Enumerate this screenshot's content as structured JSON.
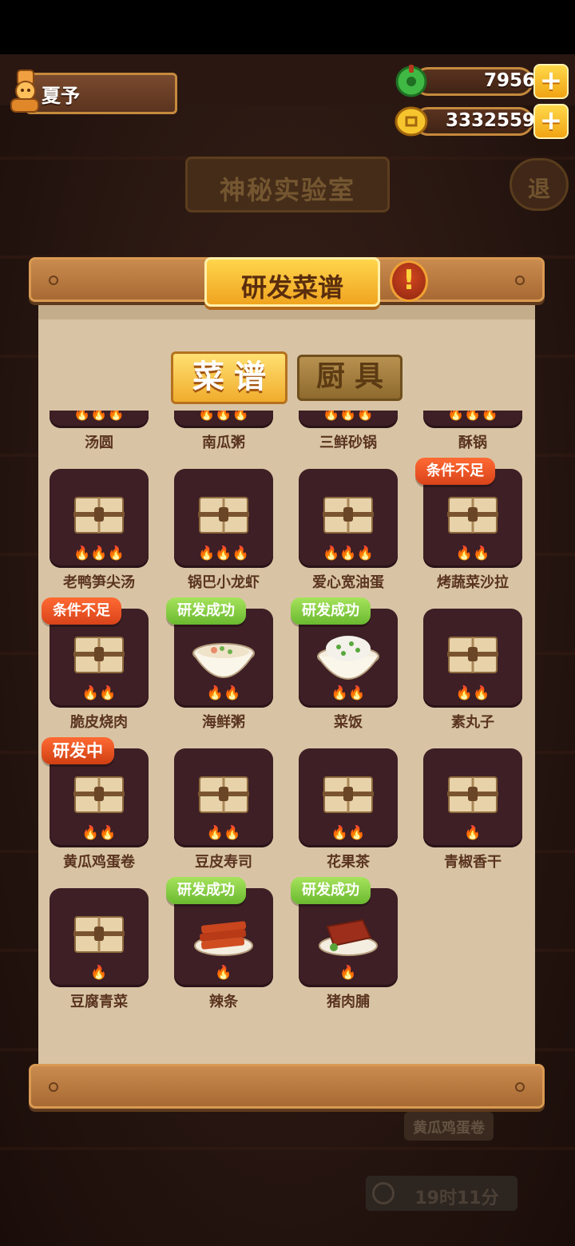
{
  "player": {
    "name": "夏予"
  },
  "currency": {
    "jade": "7956",
    "coins": "3332559",
    "plus": "+"
  },
  "room": {
    "title": "神秘实验室",
    "exit": "退"
  },
  "panel": {
    "title": "研发菜谱",
    "info": "!",
    "tabs": [
      {
        "label": "菜谱"
      },
      {
        "label": "厨具"
      }
    ],
    "recipes": [
      {
        "name": "汤圆",
        "heat": "🔥🔥🔥",
        "badge": "",
        "status": "locked"
      },
      {
        "name": "南瓜粥",
        "heat": "🔥🔥🔥",
        "badge": "",
        "status": "locked"
      },
      {
        "name": "三鲜砂锅",
        "heat": "🔥🔥🔥",
        "badge": "",
        "status": "locked"
      },
      {
        "name": "酥锅",
        "heat": "🔥🔥🔥",
        "badge": "",
        "status": "locked"
      },
      {
        "name": "老鸭笋尖汤",
        "heat": "🔥🔥🔥",
        "badge": "",
        "status": "locked"
      },
      {
        "name": "锅巴小龙虾",
        "heat": "🔥🔥🔥",
        "badge": "",
        "status": "locked"
      },
      {
        "name": "爱心宽油蛋",
        "heat": "🔥🔥🔥",
        "badge": "",
        "status": "locked"
      },
      {
        "name": "烤蔬菜沙拉",
        "heat": "🔥🔥",
        "badge": "条件不足",
        "status": "locked"
      },
      {
        "name": "脆皮烧肉",
        "heat": "🔥🔥",
        "badge": "条件不足",
        "status": "locked"
      },
      {
        "name": "海鲜粥",
        "heat": "🔥🔥",
        "badge": "研发成功",
        "status": "porridge"
      },
      {
        "name": "菜饭",
        "heat": "🔥🔥",
        "badge": "研发成功",
        "status": "rice"
      },
      {
        "name": "素丸子",
        "heat": "🔥🔥",
        "badge": "",
        "status": "locked"
      },
      {
        "name": "黄瓜鸡蛋卷",
        "heat": "🔥🔥",
        "badge": "研发中",
        "status": "locked"
      },
      {
        "name": "豆皮寿司",
        "heat": "🔥🔥",
        "badge": "",
        "status": "locked"
      },
      {
        "name": "花果茶",
        "heat": "🔥🔥",
        "badge": "",
        "status": "locked"
      },
      {
        "name": "青椒香干",
        "heat": "🔥",
        "badge": "",
        "status": "locked"
      },
      {
        "name": "豆腐青菜",
        "heat": "🔥",
        "badge": "",
        "status": "locked"
      },
      {
        "name": "辣条",
        "heat": "🔥",
        "badge": "研发成功",
        "status": "latiao"
      },
      {
        "name": "猪肉脯",
        "heat": "🔥",
        "badge": "研发成功",
        "status": "jerky"
      }
    ]
  },
  "background": {
    "tag": "黄瓜鸡蛋卷",
    "timer": "19时11分"
  },
  "colors": {
    "badge_warn": "#e8512a",
    "badge_success": "#8ccf45",
    "tile": "#3d1f25",
    "paper": "#d8c4a4"
  }
}
